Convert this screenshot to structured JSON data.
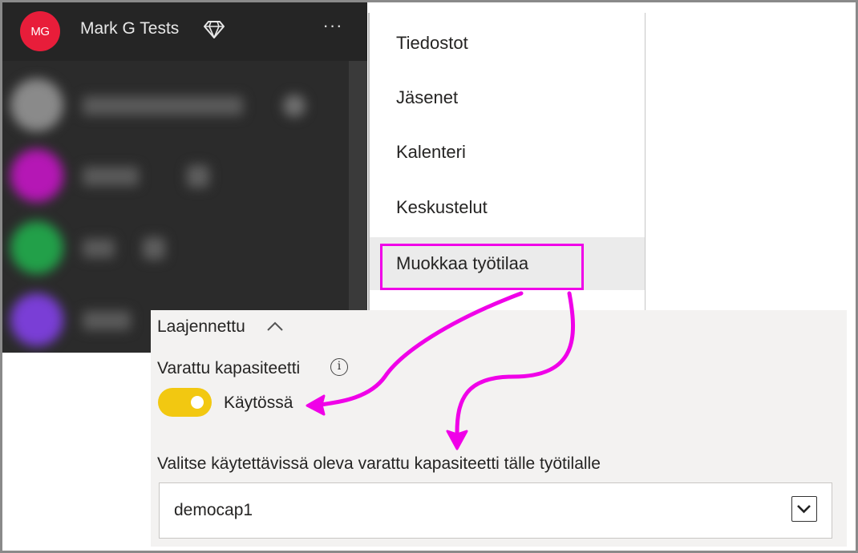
{
  "workspace": {
    "avatar_initials": "MG",
    "name": "Mark G Tests",
    "more_label": "···",
    "avatar_color": "#e81d3a"
  },
  "context_menu": {
    "items": [
      {
        "label": "Tiedostot"
      },
      {
        "label": "Jäsenet"
      },
      {
        "label": "Kalenteri"
      },
      {
        "label": "Keskustelut"
      },
      {
        "label": "Muokkaa työtilaa"
      }
    ],
    "highlight_color": "#f000e8"
  },
  "settings": {
    "advanced_label": "Laajennettu",
    "capacity_label": "Varattu kapasiteetti",
    "info_icon_glyph": "i",
    "toggle_state_label": "Käytössä",
    "toggle_on": true,
    "toggle_color": "#f2c811",
    "select_label": "Valitse käytettävissä oleva varattu kapasiteetti tälle työtilalle",
    "selected_capacity": "democap1"
  },
  "icons": {
    "workspace_premium": "diamond-icon",
    "expand": "chevron-up-icon",
    "info": "info-icon",
    "dropdown": "chevron-down-icon"
  }
}
